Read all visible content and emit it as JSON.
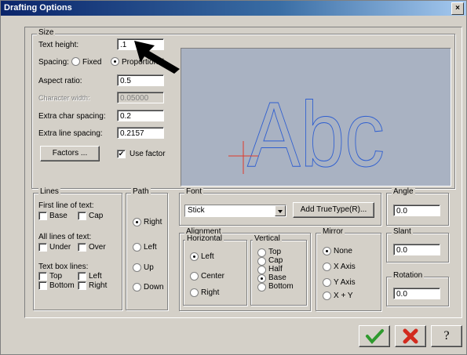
{
  "window": {
    "title": "Drafting Options",
    "close_glyph": "×"
  },
  "size": {
    "legend": "Size",
    "text_height_label": "Text height:",
    "text_height_value": ".1",
    "spacing_label": "Spacing:",
    "spacing_fixed": "Fixed",
    "spacing_proportional": "Proportional",
    "aspect_ratio_label": "Aspect ratio:",
    "aspect_ratio_value": "0.5",
    "char_width_label": "Character width:",
    "char_width_value": "0.05000",
    "extra_char_label": "Extra char spacing:",
    "extra_char_value": "0.2",
    "extra_line_label": "Extra line spacing:",
    "extra_line_value": "0.2157",
    "factors_button": "Factors ...",
    "use_factor_label": "Use factor"
  },
  "preview": {
    "sample_text": "Abc",
    "stroke_color": "#2f5fd0",
    "marker_color": "#e03a2a"
  },
  "lines": {
    "legend": "Lines",
    "first_line_label": "First line of text:",
    "base": "Base",
    "cap": "Cap",
    "all_lines_label": "All lines of text:",
    "under": "Under",
    "over": "Over",
    "text_box_label": "Text box lines:",
    "top": "Top",
    "left": "Left",
    "bottom": "Bottom",
    "right": "Right"
  },
  "path": {
    "legend": "Path",
    "right": "Right",
    "left": "Left",
    "up": "Up",
    "down": "Down"
  },
  "font": {
    "legend": "Font",
    "selected": "Stick",
    "add_truetype": "Add TrueType(R)..."
  },
  "alignment": {
    "legend": "Alignment",
    "horizontal_legend": "Horizontal",
    "h_left": "Left",
    "h_center": "Center",
    "h_right": "Right",
    "vertical_legend": "Vertical",
    "v_top": "Top",
    "v_cap": "Cap",
    "v_half": "Half",
    "v_base": "Base",
    "v_bottom": "Bottom"
  },
  "mirror": {
    "legend": "Mirror",
    "none": "None",
    "x_axis": "X Axis",
    "y_axis": "Y Axis",
    "x_y": "X + Y"
  },
  "angle": {
    "legend": "Angle",
    "value": "0.0"
  },
  "slant": {
    "legend": "Slant",
    "value": "0.0"
  },
  "rotation": {
    "legend": "Rotation",
    "value": "0.0"
  },
  "buttons": {
    "ok": "OK",
    "cancel": "Cancel",
    "help": "?"
  },
  "colors": {
    "ok_green": "#2e9a2e",
    "cancel_red": "#d22a1e",
    "title_blue": "#0a246a"
  }
}
